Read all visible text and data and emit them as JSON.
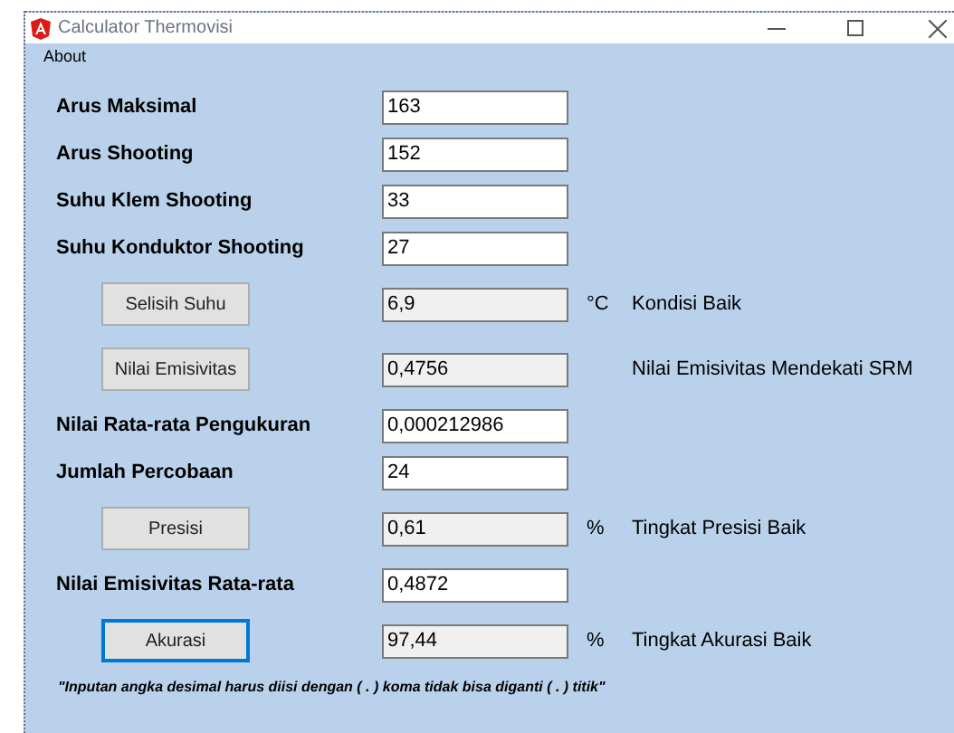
{
  "window": {
    "title": "Calculator Thermovisi"
  },
  "menu": [
    "About"
  ],
  "rows": [
    {
      "kind": "input",
      "label": "Arus Maksimal",
      "value": "163"
    },
    {
      "kind": "input",
      "label": "Arus Shooting",
      "value": "152"
    },
    {
      "kind": "input",
      "label": "Suhu Klem Shooting",
      "value": "33"
    },
    {
      "kind": "input",
      "label": "Suhu Konduktor Shooting",
      "value": "27"
    },
    {
      "kind": "compute",
      "button": "Selisih Suhu",
      "focused": false,
      "value": "6,9",
      "unit": "°C",
      "note": "Kondisi Baik"
    },
    {
      "kind": "compute",
      "button": "Nilai Emisivitas",
      "focused": false,
      "value": "0,4756",
      "note": "Nilai Emisivitas Mendekati SRM"
    },
    {
      "kind": "input",
      "label": "Nilai Rata-rata Pengukuran",
      "value": "0,000212986"
    },
    {
      "kind": "input",
      "label": "Jumlah Percobaan",
      "value": "24"
    },
    {
      "kind": "compute",
      "button": "Presisi",
      "focused": false,
      "value": "0,61",
      "unit": "%",
      "note": "Tingkat Presisi Baik"
    },
    {
      "kind": "input",
      "label": "Nilai Emisivitas Rata-rata",
      "value": "0,4872"
    },
    {
      "kind": "compute",
      "button": "Akurasi",
      "focused": true,
      "value": "97,44",
      "unit": "%",
      "note": "Tingkat Akurasi Baik"
    }
  ],
  "footer_note": "\"Inputan angka desimal harus diisi dengan ( . ) koma tidak bisa diganti ( . ) titik\""
}
